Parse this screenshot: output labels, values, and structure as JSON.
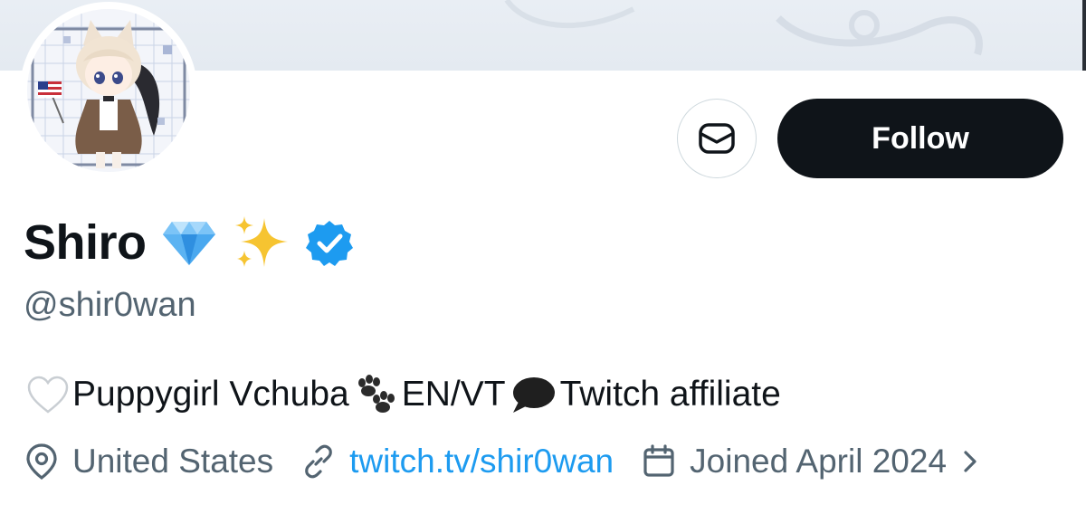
{
  "profile": {
    "display_name": "Shiro",
    "name_emojis": [
      "gem-icon",
      "sparkles-icon"
    ],
    "verified_badge": "verified-badge-icon",
    "handle": "@shir0wan"
  },
  "actions": {
    "message_icon": "envelope-icon",
    "follow_label": "Follow"
  },
  "bio": {
    "heart": "white-heart-icon",
    "part1": "Puppygirl Vchuba ",
    "paws": "paw-prints-icon",
    "part2": "EN/VT ",
    "bubble": "speech-bubble-icon",
    "part3": " Twitch affiliate"
  },
  "meta": {
    "location": "United States",
    "website": "twitch.tv/shir0wan",
    "joined": "Joined April 2024"
  },
  "colors": {
    "accent": "#1d9bf0",
    "follow_bg": "#0f1419",
    "muted_text": "#536471",
    "banner": "#e6ecf2"
  }
}
